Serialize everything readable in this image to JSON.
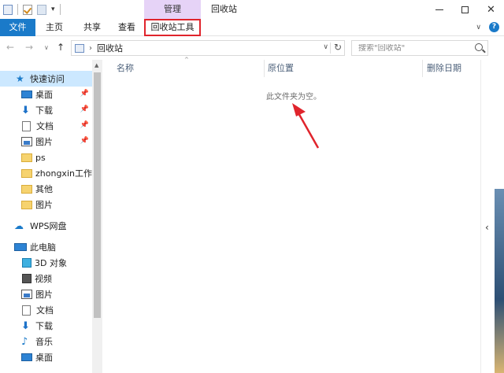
{
  "colors": {
    "accent": "#1a7ac9",
    "context_tab": "#e6d3f7",
    "highlight_box": "#e0242c",
    "selected": "#cce8ff"
  },
  "titlebar": {
    "context_label": "管理",
    "window_title": "回收站",
    "qat_dropdown": "▾",
    "minimize_icon": "minimize-icon",
    "maximize_icon": "maximize-icon",
    "close_glyph": "✕"
  },
  "ribbon": {
    "tabs": [
      {
        "label": "文件"
      },
      {
        "label": "主页"
      },
      {
        "label": "共享"
      },
      {
        "label": "查看"
      },
      {
        "label": "回收站工具"
      }
    ],
    "expand_glyph": "∨",
    "help_glyph": "?"
  },
  "nav": {
    "back": "←",
    "forward": "→",
    "recent": "∨",
    "up": "↑",
    "breadcrumb_sep": "›",
    "address": "回收站",
    "address_dropdown": "∨",
    "refresh": "↻",
    "search_placeholder": "搜索\"回收站\""
  },
  "sidebar": {
    "quick_access": "快速访问",
    "quick_items": [
      {
        "label": "桌面",
        "pinned": true
      },
      {
        "label": "下载",
        "pinned": true
      },
      {
        "label": "文档",
        "pinned": true
      },
      {
        "label": "图片",
        "pinned": true
      },
      {
        "label": "ps",
        "pinned": false
      },
      {
        "label": "zhongxin工作记",
        "pinned": false
      },
      {
        "label": "其他",
        "pinned": false
      },
      {
        "label": "图片",
        "pinned": false
      }
    ],
    "wps": "WPS网盘",
    "this_pc": "此电脑",
    "pc_items": [
      {
        "label": "3D 对象"
      },
      {
        "label": "视频"
      },
      {
        "label": "图片"
      },
      {
        "label": "文档"
      },
      {
        "label": "下载"
      },
      {
        "label": "音乐"
      },
      {
        "label": "桌面"
      }
    ],
    "pin_glyph": "📌"
  },
  "main": {
    "columns": {
      "name": "名称",
      "original_location": "原位置",
      "date_deleted": "删除日期"
    },
    "sort_glyph": "^",
    "empty_message": "此文件夹为空。"
  },
  "rightpane": {
    "collapse_glyph": "‹"
  }
}
